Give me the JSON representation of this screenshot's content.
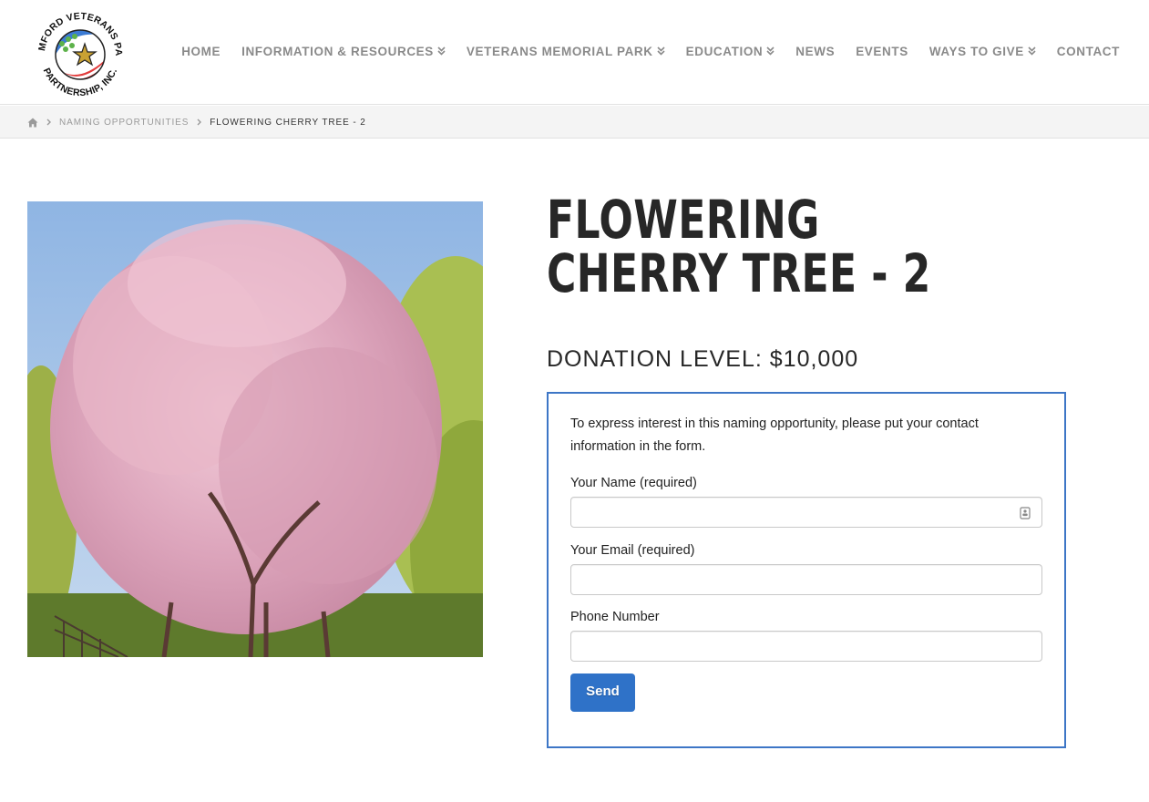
{
  "site": {
    "logo_text_top": "STAMFORD VETERANS PARK",
    "logo_text_bottom": "PARTNERSHIP, INC."
  },
  "nav": {
    "items": [
      {
        "label": "HOME",
        "dropdown": false
      },
      {
        "label": "INFORMATION & RESOURCES",
        "dropdown": true
      },
      {
        "label": "VETERANS MEMORIAL PARK",
        "dropdown": true
      },
      {
        "label": "EDUCATION",
        "dropdown": true
      },
      {
        "label": "NEWS",
        "dropdown": false
      },
      {
        "label": "EVENTS",
        "dropdown": false
      },
      {
        "label": "WAYS TO GIVE",
        "dropdown": true
      },
      {
        "label": "CONTACT",
        "dropdown": false
      }
    ]
  },
  "breadcrumb": {
    "home_icon": "home-icon",
    "parent": "NAMING OPPORTUNITIES",
    "current": "FLOWERING CHERRY TREE - 2"
  },
  "product": {
    "title": "FLOWERING CHERRY TREE - 2",
    "donation_level": "DONATION LEVEL: $10,000",
    "image_subject": "flowering cherry tree in bloom"
  },
  "form": {
    "intro": "To express interest in this naming opportunity, please put your contact information in the form.",
    "name_label": "Your Name (required)",
    "name_value": "",
    "email_label": "Your Email (required)",
    "email_value": "",
    "phone_label": "Phone Number",
    "phone_value": "",
    "send_label": "Send"
  },
  "colors": {
    "accent": "#2f72c8",
    "form_border": "#3d76c6",
    "nav_text": "#8a8a8a",
    "heading": "#272727"
  }
}
